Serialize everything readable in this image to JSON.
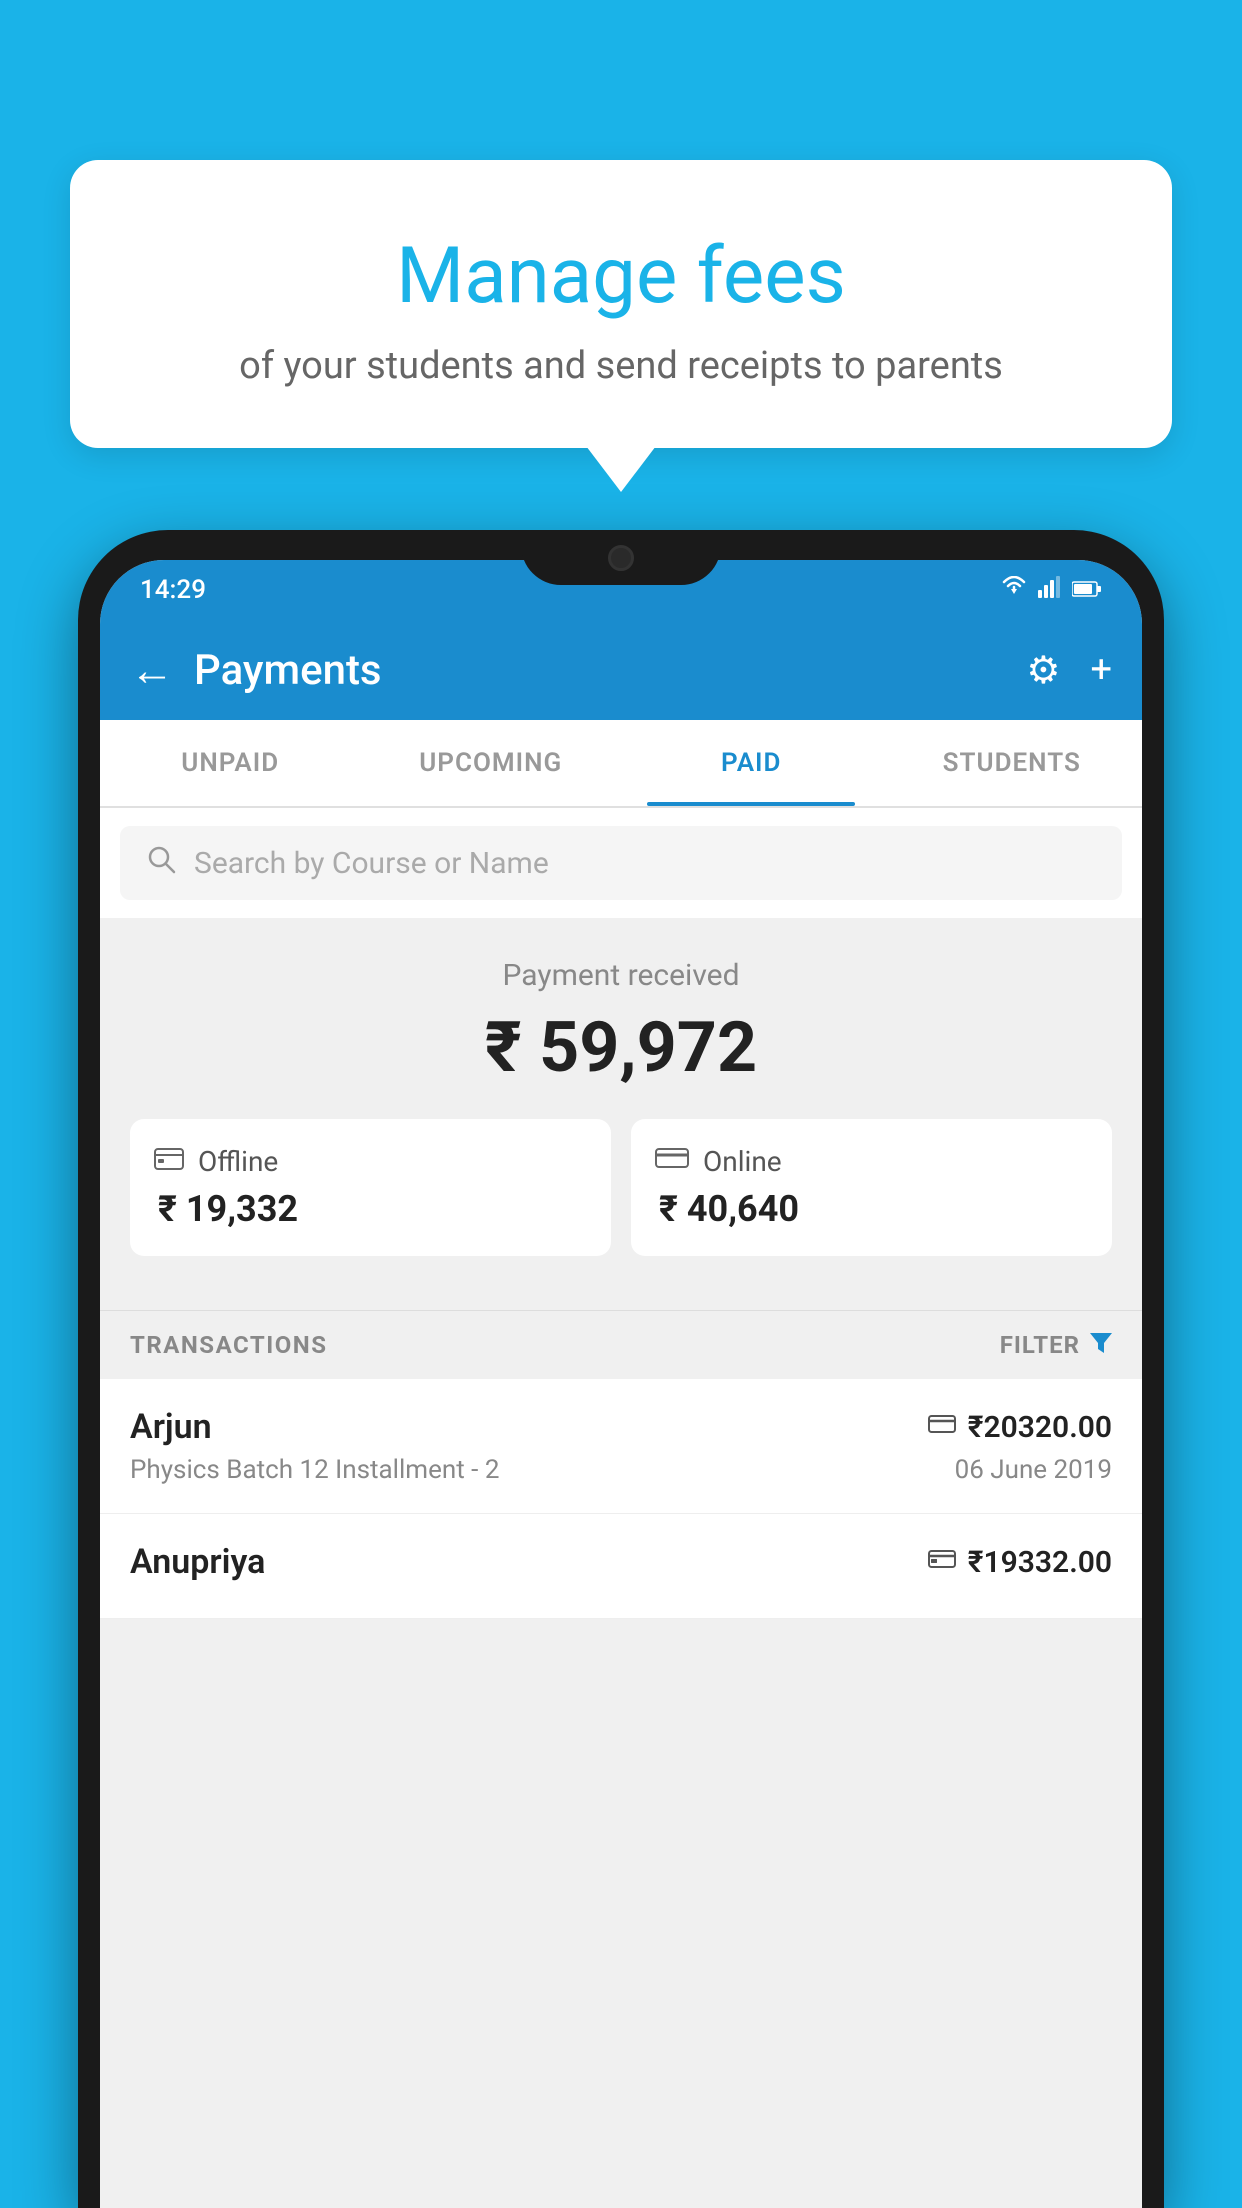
{
  "background_color": "#1ab3e8",
  "tooltip": {
    "title": "Manage fees",
    "subtitle": "of your students and send receipts to parents"
  },
  "status_bar": {
    "time": "14:29",
    "wifi": "▼",
    "signal": "▲",
    "battery": "▮"
  },
  "app_bar": {
    "back_icon": "←",
    "title": "Payments",
    "settings_icon": "⚙",
    "add_icon": "+"
  },
  "tabs": [
    {
      "label": "UNPAID",
      "active": false
    },
    {
      "label": "UPCOMING",
      "active": false
    },
    {
      "label": "PAID",
      "active": true
    },
    {
      "label": "STUDENTS",
      "active": false
    }
  ],
  "search": {
    "placeholder": "Search by Course or Name",
    "icon": "🔍"
  },
  "payment_received": {
    "label": "Payment received",
    "amount": "₹ 59,972",
    "offline": {
      "type": "Offline",
      "amount": "₹ 19,332"
    },
    "online": {
      "type": "Online",
      "amount": "₹ 40,640"
    }
  },
  "transactions": {
    "section_label": "TRANSACTIONS",
    "filter_label": "FILTER",
    "items": [
      {
        "name": "Arjun",
        "course": "Physics Batch 12 Installment - 2",
        "amount": "₹20320.00",
        "date": "06 June 2019",
        "payment_type": "online"
      },
      {
        "name": "Anupriya",
        "course": "",
        "amount": "₹19332.00",
        "date": "",
        "payment_type": "offline"
      }
    ]
  }
}
